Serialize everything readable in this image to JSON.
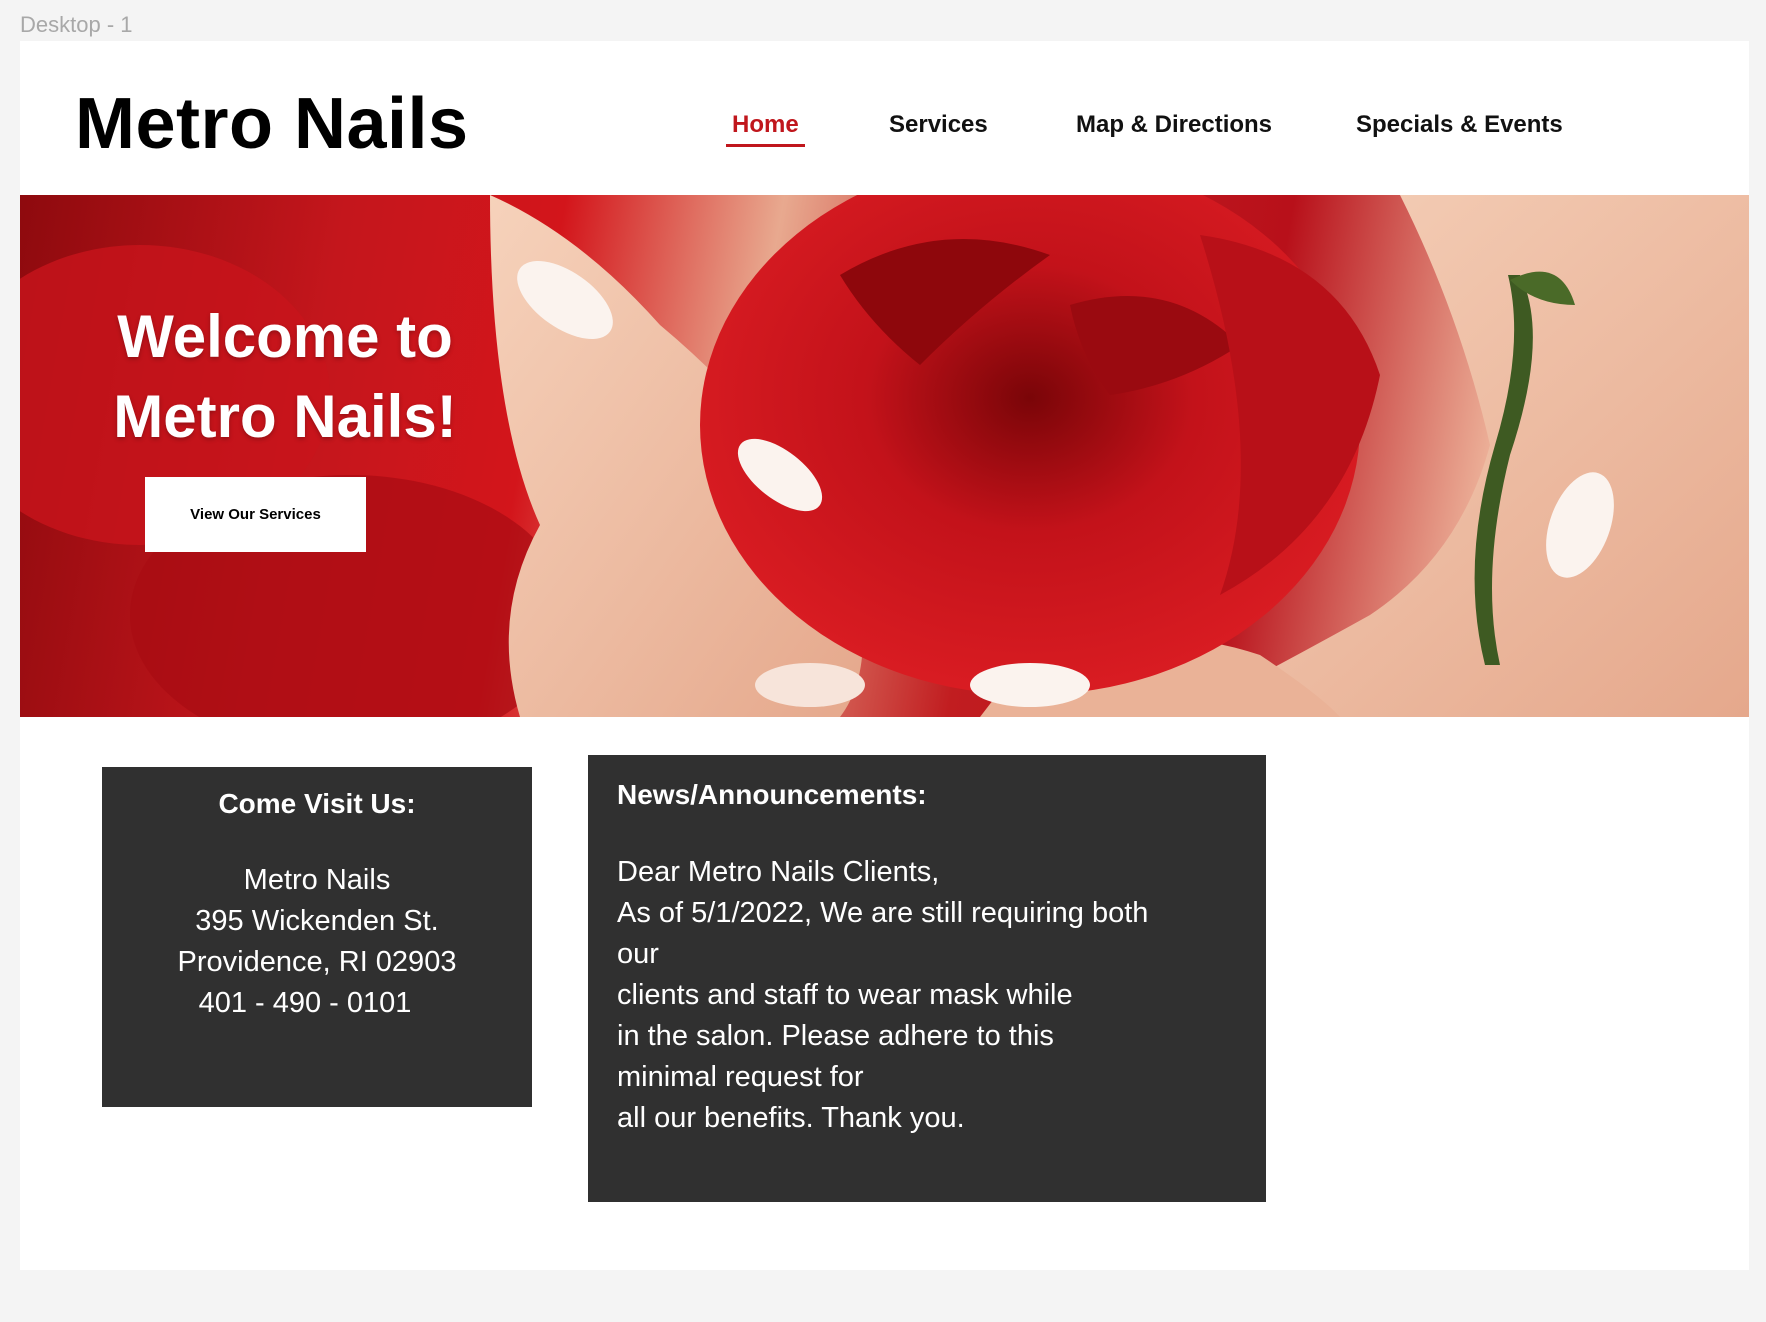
{
  "canvas": {
    "frame_label": "Desktop - 1"
  },
  "header": {
    "logo": "Metro Nails",
    "nav": [
      {
        "label": "Home",
        "active": true
      },
      {
        "label": "Services",
        "active": false
      },
      {
        "label": "Map & Directions",
        "active": false
      },
      {
        "label": "Specials & Events",
        "active": false
      }
    ]
  },
  "hero": {
    "title_line1": "Welcome to",
    "title_line2": "Metro Nails!",
    "button_label": "View Our Services"
  },
  "visit": {
    "title": "Come Visit Us:",
    "lines": [
      "Metro Nails",
      "395 Wickenden St.",
      "Providence, RI 02903",
      "401 - 490 - 0101"
    ]
  },
  "news": {
    "title": "News/Announcements:",
    "lines": [
      "Dear Metro Nails Clients,",
      "As of 5/1/2022, We are still requiring both",
      "our",
      "clients and staff to wear mask while",
      "in the salon. Please adhere to this",
      "minimal request for",
      "all our benefits. Thank you."
    ]
  },
  "colors": {
    "accent": "#c0161c",
    "panel_bg": "#303030",
    "page_bg": "#f4f4f4"
  }
}
